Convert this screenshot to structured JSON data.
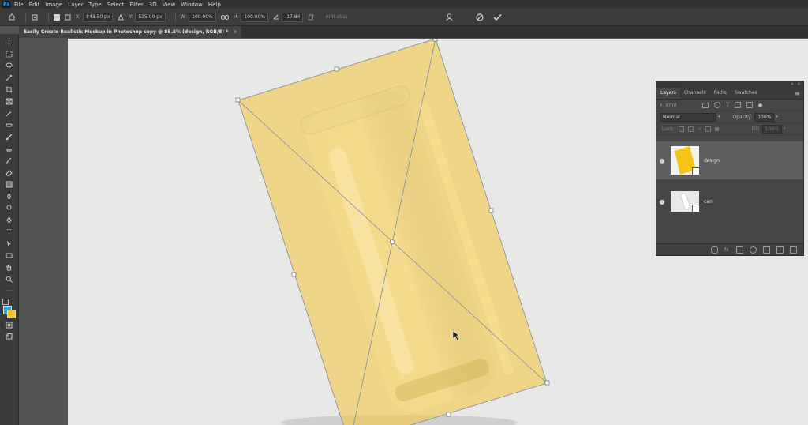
{
  "app": {
    "logo": "Ps"
  },
  "menu": [
    "File",
    "Edit",
    "Image",
    "Layer",
    "Type",
    "Select",
    "Filter",
    "3D",
    "View",
    "Window",
    "Help"
  ],
  "options": {
    "x_label": "X:",
    "x_value": "843.50 px",
    "y_label": "Y:",
    "y_value": "525.00 px",
    "w_label": "W:",
    "w_value": "100.00%",
    "h_label": "H:",
    "h_value": "100.00%",
    "angle_value": "-17.84",
    "interpolation": "Anti-alias"
  },
  "document": {
    "tab_title": "Easily Create Realistic Mockup in Photoshop copy @ 85.5% (design, RGB/8) *",
    "close": "×"
  },
  "layers_panel": {
    "tabs": [
      "Layers",
      "Channels",
      "Paths",
      "Swatches"
    ],
    "filter_placeholder": "Kind",
    "blend_mode": "Normal",
    "opacity_label": "Opacity:",
    "opacity_value": "100%",
    "lock_label": "Lock:",
    "fill_label": "Fill:",
    "fill_value": "100%",
    "layers": [
      {
        "name": "design",
        "selected": true
      },
      {
        "name": "can",
        "selected": false
      }
    ]
  },
  "colors": {
    "accent_yellow": "#f2c94c",
    "foreground": "#29a8d8",
    "background": "#f5c518"
  }
}
